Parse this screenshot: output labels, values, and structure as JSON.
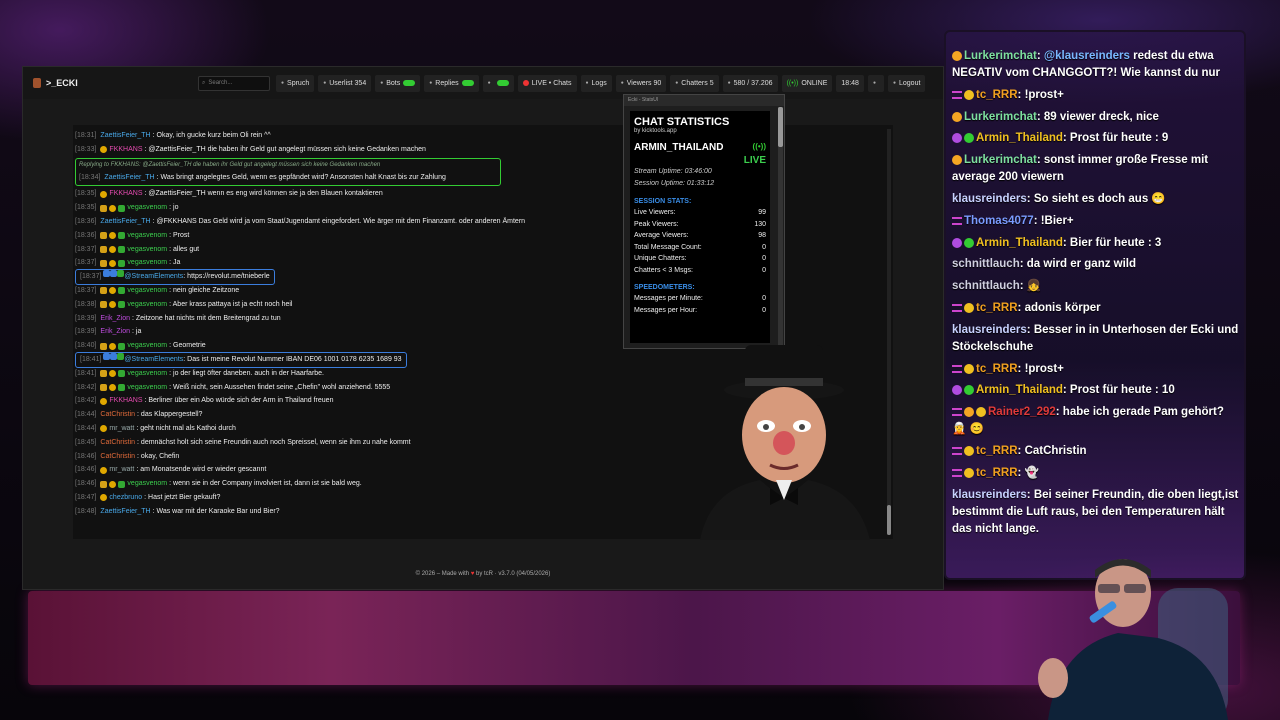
{
  "nav": {
    "brand": ">_ECKI",
    "search_placeholder": "Search...",
    "items": [
      {
        "label": "Spruch",
        "icon": "megaphone-icon"
      },
      {
        "label": "Userlist 354",
        "icon": "user-icon"
      },
      {
        "label": "Bots",
        "icon": "robot-icon",
        "toggle": true
      },
      {
        "label": "Replies",
        "icon": "reply-icon",
        "toggle": true
      },
      {
        "label": "",
        "icon": "users-icon",
        "toggle": true
      },
      {
        "label": "LIVE • Chats",
        "icon": "live-dot-icon"
      },
      {
        "label": "Logs",
        "icon": "file-icon"
      },
      {
        "label": "Viewers 90",
        "icon": "eye-icon"
      },
      {
        "label": "Chatters 5",
        "icon": "chat-icon"
      },
      {
        "label": "580 / 37.206",
        "icon": "star-icon"
      },
      {
        "label": "ONLINE",
        "icon": "signal-icon"
      },
      {
        "label": "18:48",
        "icon": ""
      },
      {
        "label": "",
        "icon": "moon-icon"
      },
      {
        "label": "Logout",
        "icon": "logout-icon"
      }
    ]
  },
  "chat": {
    "messages": [
      {
        "time": "[18:31]",
        "badges": [],
        "user": "ZaettisFeier_TH",
        "color": "blue",
        "text": ": Okay, ich gucke kurz beim Oli rein ^^"
      },
      {
        "time": "[18:33]",
        "badges": [
          "sub"
        ],
        "user": "FKKHANS",
        "color": "pink",
        "text": ": @ZaettisFeier_TH die haben ihr Geld gut angelegt müssen sich keine Gedanken machen"
      },
      {
        "time": "[18:34]",
        "badges": [],
        "user": "ZaettisFeier_TH",
        "color": "blue",
        "text": ": Was bringt angelegtes Geld, wenn es gepfändet wird? Ansonsten halt Knast bis zur Zahlung",
        "reply": "Replying to FKKHANS: @ZaettisFeier_TH die haben ihr Geld gut angelegt müssen sich keine Gedanken machen"
      },
      {
        "time": "[18:35]",
        "badges": [
          "sub"
        ],
        "user": "FKKHANS",
        "color": "pink",
        "text": ": @ZaettisFeier_TH wenn es eng wird können sie ja den Blauen kontaktieren"
      },
      {
        "time": "[18:35]",
        "badges": [
          "crown",
          "sub",
          "mod"
        ],
        "user": "vegasvenom",
        "color": "green",
        "text": ": jo"
      },
      {
        "time": "[18:36]",
        "badges": [],
        "user": "ZaettisFeier_TH",
        "color": "blue",
        "text": ": @FKKHANS Das Geld wird ja vom Staat/Jugendamt eingefordert. Wie ärger mit dem Finanzamt. oder anderen Ämtern"
      },
      {
        "time": "[18:36]",
        "badges": [
          "crown",
          "sub",
          "mod"
        ],
        "user": "vegasvenom",
        "color": "green",
        "text": ": Prost"
      },
      {
        "time": "[18:37]",
        "badges": [
          "crown",
          "sub",
          "mod"
        ],
        "user": "vegasvenom",
        "color": "green",
        "text": ": alles gut"
      },
      {
        "time": "[18:37]",
        "badges": [
          "crown",
          "sub",
          "mod"
        ],
        "user": "vegasvenom",
        "color": "green",
        "text": ": Ja"
      },
      {
        "time": "[18:37]",
        "badges": [
          "bot",
          "bot",
          "mod"
        ],
        "user": "@StreamElements",
        "color": "blue",
        "text": ": https://revolut.me/tnieberle",
        "stream": true
      },
      {
        "time": "[18:37]",
        "badges": [
          "crown",
          "sub",
          "mod"
        ],
        "user": "vegasvenom",
        "color": "green",
        "text": ": nein gleiche Zeitzone"
      },
      {
        "time": "[18:38]",
        "badges": [
          "crown",
          "sub",
          "mod"
        ],
        "user": "vegasvenom",
        "color": "green",
        "text": ": Aber krass pattaya ist ja echt noch heil"
      },
      {
        "time": "[18:39]",
        "badges": [],
        "user": "Erik_Zion",
        "color": "purple",
        "text": ": Zeitzone hat nichts mit dem Breitengrad zu tun"
      },
      {
        "time": "[18:39]",
        "badges": [],
        "user": "Erik_Zion",
        "color": "purple",
        "text": ": ja"
      },
      {
        "time": "[18:40]",
        "badges": [
          "crown",
          "sub",
          "mod"
        ],
        "user": "vegasvenom",
        "color": "green",
        "text": ": Geometrie"
      },
      {
        "time": "[18:41]",
        "badges": [
          "bot",
          "bot",
          "mod"
        ],
        "user": "@StreamElements",
        "color": "blue",
        "text": ": Das ist meine Revolut Nummer IBAN DE06 1001 0178 6235 1689 93",
        "stream": true
      },
      {
        "time": "[18:41]",
        "badges": [
          "crown",
          "sub",
          "mod"
        ],
        "user": "vegasvenom",
        "color": "green",
        "text": ": jo der liegt öfter daneben. auch in der Haarfarbe."
      },
      {
        "time": "[18:42]",
        "badges": [
          "crown",
          "sub",
          "mod"
        ],
        "user": "vegasvenom",
        "color": "green",
        "text": ": Weiß nicht, sein Aussehen findet seine „Chefin\" wohl anziehend. 5555"
      },
      {
        "time": "[18:42]",
        "badges": [
          "sub"
        ],
        "user": "FKKHANS",
        "color": "pink",
        "text": ": Berliner über ein Abo würde sich der Arm in Thailand freuen"
      },
      {
        "time": "[18:44]",
        "badges": [],
        "user": "CatChristin",
        "color": "orange",
        "text": ": das Klappergestell?"
      },
      {
        "time": "[18:44]",
        "badges": [
          "sub"
        ],
        "user": "mr_watt",
        "color": "gray",
        "text": ": geht nicht mal als Kathoi durch"
      },
      {
        "time": "[18:45]",
        "badges": [],
        "user": "CatChristin",
        "color": "orange",
        "text": ": demnächst holt sich seine Freundin auch noch Spreissel, wenn sie ihm zu nahe kommt"
      },
      {
        "time": "[18:46]",
        "badges": [],
        "user": "CatChristin",
        "color": "orange",
        "text": ": okay, Chefin"
      },
      {
        "time": "[18:46]",
        "badges": [
          "sub"
        ],
        "user": "mr_watt",
        "color": "gray",
        "text": ": am Monatsende wird er wieder gescannt"
      },
      {
        "time": "[18:46]",
        "badges": [
          "crown",
          "sub",
          "mod"
        ],
        "user": "vegasvenom",
        "color": "green",
        "text": ": wenn sie in der Company involviert ist, dann ist sie bald weg."
      },
      {
        "time": "[18:47]",
        "badges": [
          "sub"
        ],
        "user": "chezbruno",
        "color": "blue",
        "text": ": Hast jetzt Bier gekauft?"
      },
      {
        "time": "[18:48]",
        "badges": [],
        "user": "ZaettisFeier_TH",
        "color": "blue",
        "text": ": Was war mit der Karaoke Bar und Bier?"
      }
    ]
  },
  "footer": {
    "pre": "© 2026 – Made with",
    "post": "by tcR · v3.7.0 (04/05/2026)"
  },
  "stats": {
    "titlebar": "Ecki - StatsUl",
    "title": "CHAT STATISTICS",
    "subtitle": "by kicktools.app",
    "user": "ARMIN_THAILAND",
    "live": "LIVE",
    "stream_uptime": "Stream Uptime: 03:46:00",
    "session_uptime": "Session Uptime: 01:33:12",
    "session_head": "SESSION STATS:",
    "rows": [
      {
        "label": "Live Viewers:",
        "value": "99"
      },
      {
        "label": "Peak Viewers:",
        "value": "130"
      },
      {
        "label": "Average Viewers:",
        "value": "98"
      },
      {
        "label": "Total Message Count:",
        "value": "0"
      },
      {
        "label": "Unique Chatters:",
        "value": "0"
      },
      {
        "label": "Chatters < 3 Msgs:",
        "value": "0"
      }
    ],
    "speed_head": "SPEEDOMETERS:",
    "speed_rows": [
      {
        "label": "Messages per Minute:",
        "value": "0"
      },
      {
        "label": "Messages per Hour:",
        "value": "0"
      }
    ]
  },
  "overlay_chat": [
    {
      "icon": "warn",
      "user": "Lurkerimchat",
      "cls": "u-lurker",
      "text": ": ",
      "mention": "@klausreinders",
      "rest": " redest du etwa NEGATIV vom CHANGGOTT?! Wie kannst du nur"
    },
    {
      "icon": "bars-crown",
      "user": "tc_RRR",
      "cls": "u-tc",
      "text": ": !prost+"
    },
    {
      "icon": "warn",
      "user": "Lurkerimchat",
      "cls": "u-lurker",
      "text": ": 89 viewer dreck, nice"
    },
    {
      "icon": "mic-mod",
      "user": "Armin_Thailand",
      "cls": "u-armin",
      "text": ": Prost für heute : 9"
    },
    {
      "icon": "warn",
      "user": "Lurkerimchat",
      "cls": "u-lurker",
      "text": ": sonst immer große Fresse mit average 200 viewern"
    },
    {
      "icon": "",
      "user": "klausreinders",
      "cls": "u-klaus",
      "text": ": So sieht es doch aus 😁"
    },
    {
      "icon": "bars",
      "user": "Thomas4077",
      "cls": "u-thomas",
      "text": ": !Bier+"
    },
    {
      "icon": "mic-mod",
      "user": "Armin_Thailand",
      "cls": "u-armin",
      "text": ": Bier für heute : 3"
    },
    {
      "icon": "",
      "user": "schnittlauch",
      "cls": "u-schnitt",
      "text": ": da wird er ganz wild"
    },
    {
      "icon": "",
      "user": "schnittlauch",
      "cls": "u-schnitt",
      "text": ": 👧"
    },
    {
      "icon": "bars-crown",
      "user": "tc_RRR",
      "cls": "u-tc",
      "text": ": adonis körper"
    },
    {
      "icon": "",
      "user": "klausreinders",
      "cls": "u-klaus",
      "text": ": Besser in in Unterhosen der Ecki und Stöckelschuhe"
    },
    {
      "icon": "bars-crown",
      "user": "tc_RRR",
      "cls": "u-tc",
      "text": ": !prost+"
    },
    {
      "icon": "mic-mod",
      "user": "Armin_Thailand",
      "cls": "u-armin",
      "text": ": Prost für heute : 10"
    },
    {
      "icon": "bars-warn-crown",
      "user": "Rainer2_292",
      "cls": "u-rainer",
      "text": ": habe ich gerade Pam gehört? 🧝 😊"
    },
    {
      "icon": "bars-crown",
      "user": "tc_RRR",
      "cls": "u-tc",
      "text": ": CatChristin"
    },
    {
      "icon": "bars-crown",
      "user": "tc_RRR",
      "cls": "u-tc",
      "text": ": 👻"
    },
    {
      "icon": "",
      "user": "klausreinders",
      "cls": "u-klaus",
      "text": ": Bei seiner Freundin, die oben liegt,ist bestimmt die Luft raus, bei den Temperaturen hält das nicht lange."
    }
  ]
}
